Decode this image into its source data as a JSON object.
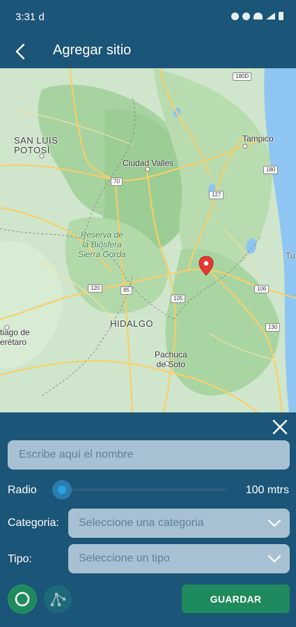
{
  "statusbar": {
    "time": "3:31",
    "carrier_glyph": "d",
    "icons": [
      "sync-icon",
      "alarm-icon",
      "wifi-icon",
      "signal-icon",
      "battery-icon"
    ]
  },
  "appbar": {
    "title": "Agregar sitio",
    "back_icon": "chevron-left-icon"
  },
  "map": {
    "labels": {
      "san_luis": "SAN LUIS\nPOTOSÍ",
      "ciudad_valles": "Ciudad Valles",
      "tampico": "Tampico",
      "reserva": "Reserva de\nla Biósfera\nSierra Gorda",
      "hidalgo": "HIDALGO",
      "pachuca": "Pachuca\nde Soto",
      "santiago": "tiago de\nerétaro",
      "tu": "Tu"
    },
    "shields": [
      "70",
      "180",
      "127",
      "120",
      "85",
      "105",
      "106",
      "130",
      "180D"
    ],
    "marker_icon": "map-pin-icon",
    "colors": {
      "land": "#cfe6cc",
      "forest": "#a7d3a0",
      "water": "#8ec5f2",
      "road": "#f6cf6a",
      "pin": "#e53935"
    }
  },
  "panel": {
    "close_icon": "close-icon",
    "name_placeholder": "Escribe aquí el nombre",
    "name_value": "",
    "radio_label": "Radio",
    "radio_value_text": "100 mtrs",
    "radio_fraction": 0.0,
    "category_label": "Categoria:",
    "category_placeholder": "Seleccione una categoria",
    "type_label": "Tipo:",
    "type_placeholder": "Seleccione un tipo",
    "circle_mode_icon": "circle-icon",
    "polygon_mode_icon": "polygon-icon",
    "save_label": "GUARDAR"
  },
  "colors": {
    "primary": "#1b5577",
    "input_bg": "#a8c1d2",
    "accent_green": "#1f8a5d",
    "slider_blue": "#2d9fe0"
  }
}
